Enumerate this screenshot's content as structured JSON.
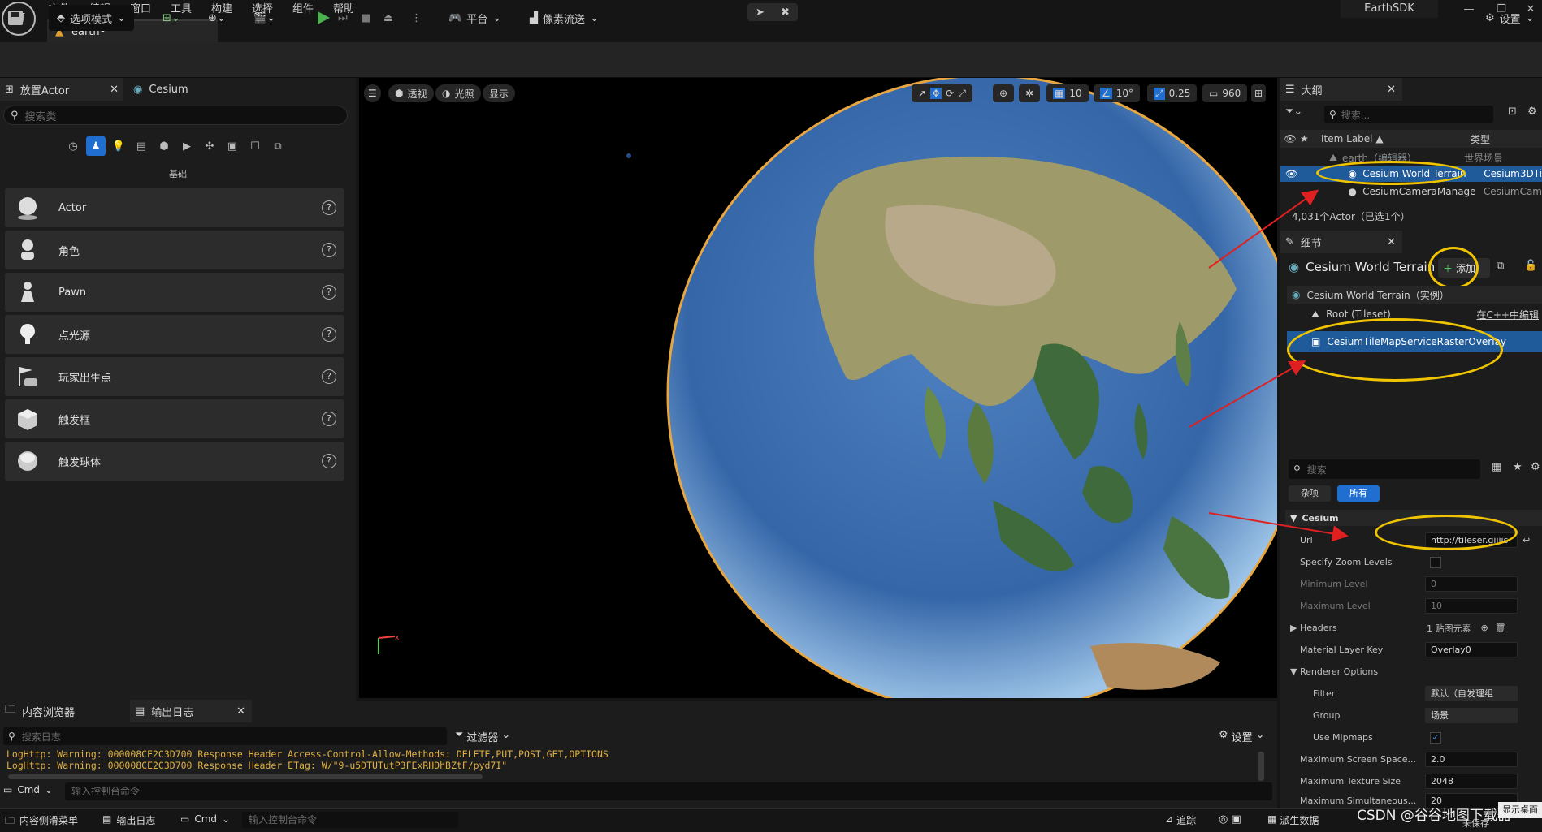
{
  "title_bar": {
    "menu": [
      "文件",
      "编辑",
      "窗口",
      "工具",
      "构建",
      "选择",
      "组件",
      "帮助"
    ],
    "doc_tab": "earth•",
    "app_name": "EarthSDK",
    "win_buttons": [
      "—",
      "❐",
      "✕"
    ]
  },
  "toolbar": {
    "mode_label": "选项模式",
    "platform_label": "平台",
    "pixel_stream_label": "像素流送",
    "settings_label": "设置"
  },
  "left_panel": {
    "tab_place_actor": "放置Actor",
    "tab_cesium": "Cesium",
    "search_placeholder": "搜索类",
    "category_label": "基础",
    "items": [
      "Actor",
      "角色",
      "Pawn",
      "点光源",
      "玩家出生点",
      "触发框",
      "触发球体"
    ]
  },
  "viewport": {
    "btn_perspective": "透视",
    "btn_lit": "光照",
    "btn_show": "显示",
    "grid_value": "10",
    "angle_value": "10°",
    "scale_value": "0.25",
    "camera_speed": "960"
  },
  "outliner": {
    "tab": "大纲",
    "search_placeholder": "搜索...",
    "col_label": "Item Label ▲",
    "col_type": "类型",
    "rows": [
      {
        "label": "earth（编辑器）",
        "type": "世界场景"
      },
      {
        "label": "Cesium World Terrain",
        "type": "Cesium3DTi"
      },
      {
        "label": "CesiumCameraManage",
        "type": "CesiumCam"
      }
    ],
    "count_text": "4,031个Actor（已选1个）"
  },
  "details": {
    "tab": "细节",
    "object_name": "Cesium World Terrain",
    "add_label": "添加",
    "instance_label": "Cesium World Terrain（实例）",
    "root_label": "Root (Tileset)",
    "root_edit": "在C++中编辑",
    "overlay_label": "CesiumTileMapServiceRasterOverlay",
    "search_placeholder": "搜索",
    "filter_misc": "杂项",
    "filter_all": "所有",
    "section_cesium": "Cesium",
    "url_label": "Url",
    "url_value": "http://tileser.giiiis",
    "specify_zoom_label": "Specify Zoom Levels",
    "min_level_label": "Minimum Level",
    "min_level_value": "0",
    "max_level_label": "Maximum Level",
    "max_level_value": "10",
    "headers_label": "Headers",
    "headers_value": "1 贴图元素",
    "material_key_label": "Material Layer Key",
    "material_key_value": "Overlay0",
    "renderer_label": "Renderer Options",
    "filter_label": "Filter",
    "filter_value": "默认（自发理组",
    "group_label": "Group",
    "group_value": "场景",
    "mipmaps_label": "Use Mipmaps",
    "max_screen_label": "Maximum Screen Space...",
    "max_screen_value": "2.0",
    "max_texture_label": "Maximum Texture Size",
    "max_texture_value": "2048",
    "max_simul_label": "Maximum Simultaneous...",
    "max_simul_value": "20"
  },
  "bottom": {
    "tab_content": "内容浏览器",
    "tab_output": "输出日志",
    "search_placeholder": "搜索日志",
    "filter_label": "过滤器",
    "settings_label": "设置",
    "log_lines": [
      "LogHttp: Warning: 000008CE2C3D700 Response Header Access-Control-Allow-Methods: DELETE,PUT,POST,GET,OPTIONS",
      "LogHttp: Warning: 000008CE2C3D700 Response Header ETag: W/\"9-u5DTUTutP3FExRHDhBZtF/pyd7I\""
    ],
    "cmd_label": "Cmd",
    "cmd_placeholder": "输入控制台命令"
  },
  "status_bar": {
    "drawer": "内容侧滑菜单",
    "output": "输出日志",
    "cmd": "Cmd",
    "cmd_placeholder": "输入控制台命令",
    "trace": "追踪",
    "derived": "派生数据",
    "save": "未保存",
    "watermark": "CSDN @谷谷地图下载器",
    "show_desktop": "显示桌面"
  },
  "colors": {
    "annotation": "#f0c400",
    "arrow": "#e02020",
    "select_blue": "#1f5a9a"
  }
}
